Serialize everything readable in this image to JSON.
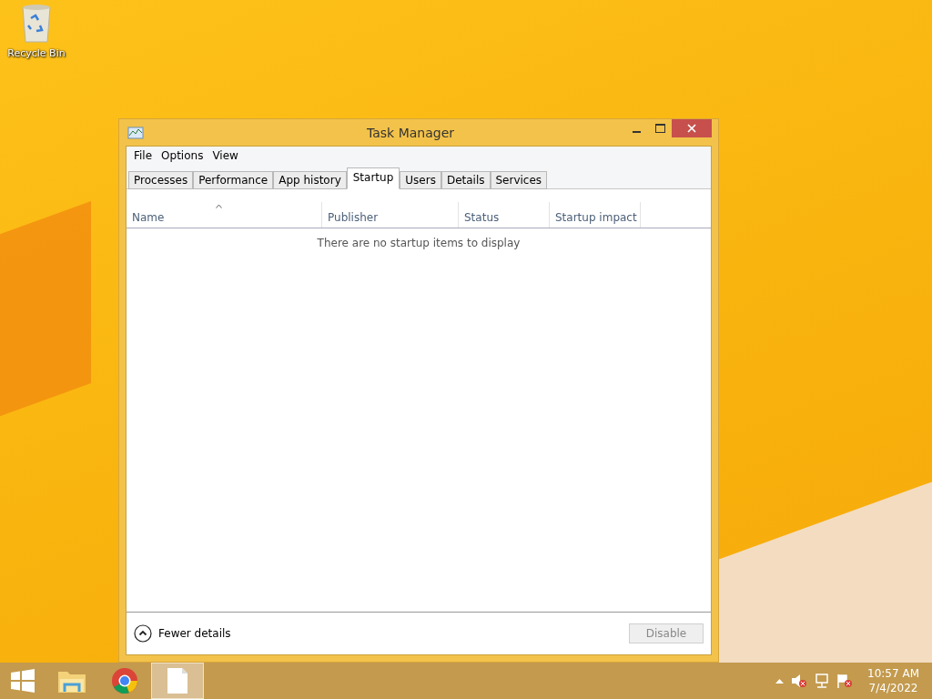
{
  "desktop_icons": [
    {
      "label": "Recycle Bin"
    }
  ],
  "window": {
    "title": "Task Manager",
    "menu": [
      "File",
      "Options",
      "View"
    ],
    "tabs": [
      {
        "label": "Processes",
        "selected": false
      },
      {
        "label": "Performance",
        "selected": false
      },
      {
        "label": "App history",
        "selected": false
      },
      {
        "label": "Startup",
        "selected": true
      },
      {
        "label": "Users",
        "selected": false
      },
      {
        "label": "Details",
        "selected": false
      },
      {
        "label": "Services",
        "selected": false
      }
    ],
    "columns": [
      {
        "label": "Name",
        "sorted": true
      },
      {
        "label": "Publisher",
        "sorted": false
      },
      {
        "label": "Status",
        "sorted": false
      },
      {
        "label": "Startup impact",
        "sorted": false
      }
    ],
    "empty_message": "There are no startup items to display",
    "fewer_details": "Fewer details",
    "disable_button": {
      "label": "Disable",
      "disabled": true
    }
  },
  "taskbar": {
    "apps": [
      {
        "kind": "start",
        "selected": false
      },
      {
        "kind": "folder",
        "selected": false
      },
      {
        "kind": "browser",
        "selected": false
      },
      {
        "kind": "document",
        "selected": true
      }
    ],
    "time": "10:57 AM",
    "date": "7/4/2022"
  }
}
